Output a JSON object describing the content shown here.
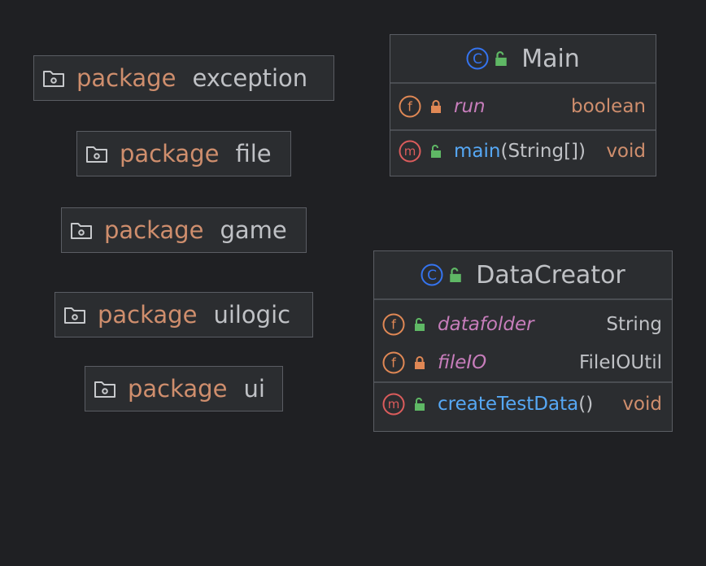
{
  "packages": [
    {
      "keyword": "package",
      "name": "exception"
    },
    {
      "keyword": "package",
      "name": "file"
    },
    {
      "keyword": "package",
      "name": "game"
    },
    {
      "keyword": "package",
      "name": "uilogic"
    },
    {
      "keyword": "package",
      "name": "ui"
    }
  ],
  "classes": {
    "main": {
      "name": "Main",
      "fields": [
        {
          "name": "run",
          "type": "boolean",
          "visibility": "private"
        }
      ],
      "methods": [
        {
          "name": "main",
          "params": "(String[])",
          "return_type": "void",
          "visibility": "public"
        }
      ]
    },
    "datacreator": {
      "name": "DataCreator",
      "fields": [
        {
          "name": "datafolder",
          "type": "String",
          "visibility": "public"
        },
        {
          "name": "fileIO",
          "type": "FileIOUtil",
          "visibility": "private"
        }
      ],
      "methods": [
        {
          "name": "createTestData",
          "params": "()",
          "return_type": "void",
          "visibility": "public"
        }
      ]
    }
  },
  "icons": {
    "package": "folder-icon",
    "class": "class-c-icon",
    "field": "field-f-icon",
    "method": "method-m-icon",
    "public": "lock-open-icon",
    "private": "lock-closed-icon"
  },
  "colors": {
    "background": "#1f2023",
    "node_fill": "#2b2d30",
    "keyword": "#cf8e6d",
    "field_name": "#c77dbb",
    "method_name": "#56a8f5",
    "class_icon": "#3574f0",
    "field_icon": "#e08855",
    "method_icon": "#db5c5c",
    "public_lock": "#5fb865",
    "private_lock": "#e08855"
  }
}
